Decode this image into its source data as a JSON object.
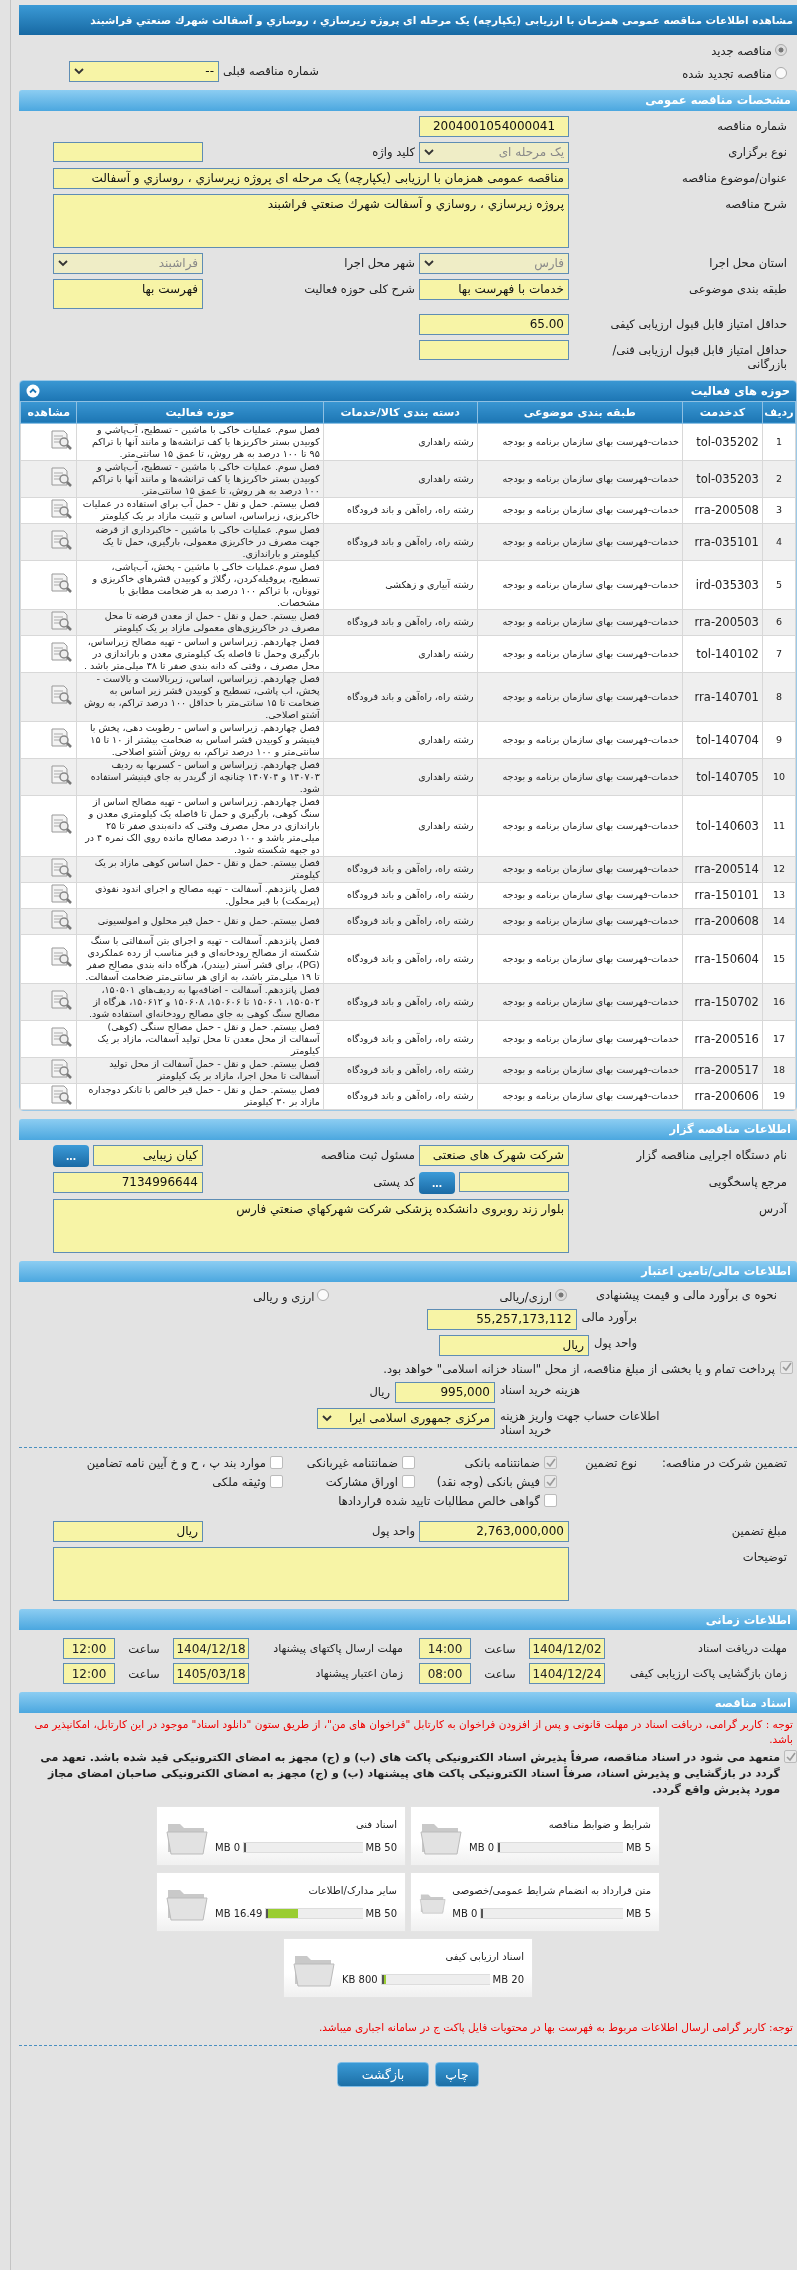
{
  "header": {
    "title": "مشاهده اطلاعات مناقصه عمومی همزمان با ارزیابی (یکپارچه) یک مرحله ای پروژه زیرسازي ، روسازي و آسفالت شهرك صنعتي فراشبند"
  },
  "tender_status": [
    {
      "label": "مناقصه جدید",
      "selected": true
    },
    {
      "label": "مناقصه تجدید شده",
      "selected": false
    }
  ],
  "previous_tender": {
    "label": "شماره مناقصه قبلی",
    "value": "--",
    "kind": "select",
    "disabled": false
  },
  "general": {
    "title": "مشخصات مناقصه عمومی",
    "rows": [
      [
        {
          "label": "شماره مناقصه",
          "kind": "code",
          "value": "2004001054000041"
        }
      ],
      [
        {
          "label": "نوع برگزاری",
          "kind": "select",
          "value": "یک مرحله ای",
          "disabled": true
        },
        {
          "label": "کلید واژه",
          "kind": "text"
        }
      ],
      [
        {
          "label": "عنوان/موضوع مناقصه",
          "kind": "wide",
          "value": "مناقصه عمومی همزمان با ارزیابی (یکپارچه) یک مرحله ای پروژه زیرسازي ، روسازي و آسفالت"
        }
      ],
      [
        {
          "label": "شرح مناقصه",
          "kind": "widearea",
          "value": "پروژه زیرسازي ، روسازي و آسفالت شهرك صنعتي فراشبند"
        }
      ],
      [
        {
          "label": "استان محل اجرا",
          "kind": "select",
          "value": "فارس",
          "disabled": true
        },
        {
          "label": "شهر محل اجرا",
          "kind": "select",
          "value": "فراشبند",
          "disabled": true
        }
      ],
      [
        {
          "label": "طبقه بندی موضوعی",
          "kind": "text",
          "value": "خدمات با فهرست بها"
        },
        {
          "label": "شرح کلی حوزه فعالیت",
          "kind": "area",
          "value": "فهرست بها"
        }
      ],
      [
        {
          "label": "حداقل امتیاز قابل قبول ارزیابی کیفی",
          "kind": "text",
          "value": "65.00"
        }
      ],
      [
        {
          "label": "حداقل امتیاز قابل قبول ارزیابی فنی/بازرگانی",
          "kind": "text"
        }
      ]
    ]
  },
  "activities": {
    "title": "حوزه های فعالیت",
    "columns": [
      "ردیف",
      "کدخدمت",
      "طبقه بندی موضوعی",
      "دسته بندی کالا/خدمات",
      "حوزه فعالیت",
      "مشاهده"
    ],
    "rows": [
      [
        "1",
        "tol-035202",
        "خدمات-فهرست بهای سازمان برنامه و بودجه",
        "رشته راهداری",
        "فصل سوم. عملیات خاکی با ماشین - تسطیح، آب‌پاشي و کوبیدن بستر خاکریزها یا کف ترانشه‌ها و مانند آنها با تراکم ۹۵ تا ۱۰۰ درصد به هر روش، تا عمق ۱۵ سانتی‌متر."
      ],
      [
        "2",
        "tol-035203",
        "خدمات-فهرست بهای سازمان برنامه و بودجه",
        "رشته راهداری",
        "فصل سوم. عملیات خاکی با ماشین - تسطیح، آب‌پاشي و کوبیدن بستر خاکریزها یا کف ترانشه‌ها و مانند آنها با تراکم ۱۰۰ درصد به هر روش، تا عمق ۱۵ سانتی‌متر."
      ],
      [
        "3",
        "rra-200508",
        "خدمات-فهرست بهای سازمان برنامه و بودجه",
        "رشته راه، راه‌آهن و باند فرودگاه",
        "فصل بیستم. حمل و نقل - حمل آب برای استفاده در عملیات خاکریزی، زیراساس، اساس و تثبیت مازاد بر یک کیلومتر"
      ],
      [
        "4",
        "rra-035101",
        "خدمات-فهرست بهای سازمان برنامه و بودجه",
        "رشته راه، راه‌آهن و باند فرودگاه",
        "فصل سوم. عملیات خاکی با ماشین - خاکبرداری از قرضه جهت مصرف در خاکریزی معمولی، بارگیری، حمل تا یک کیلومتر و باراندازی."
      ],
      [
        "5",
        "ird-035303",
        "خدمات-فهرست بهای سازمان برنامه و بودجه",
        "رشته آبیاری و زهکشی",
        "فصل سوم.عملیات خاکی با ماشین - پخش، آب‌پاشی، تسطیح، پروفیله‌کردن، رگلاژ و کوبیدن قشرهای خاکریزی و توونان، با تراکم ۱۰۰ درصد به هر ضخامت مطابق با مشخصات."
      ],
      [
        "6",
        "rra-200503",
        "خدمات-فهرست بهای سازمان برنامه و بودجه",
        "رشته راه، راه‌آهن و باند فرودگاه",
        "فصل بیستم. حمل و نقل - حمل از معدن قرضه تا محل مصرف در خاکریزی‌های معمولی مازاد بر یک کیلومتر"
      ],
      [
        "7",
        "tol-140102",
        "خدمات-فهرست بهای سازمان برنامه و بودجه",
        "رشته راهداری",
        "فصل چهاردهم. زیراساس و اساس - تهیه مصالح زیراساس، بارگیری وحمل تا فاصله یک کیلومتری معدن و باراندازی در محل مصرف ، وقتی که دانه بندی صفر تا ۳۸ میلی‌متر باشد ."
      ],
      [
        "8",
        "rra-140701",
        "خدمات-فهرست بهای سازمان برنامه و بودجه",
        "رشته راه، راه‌آهن و باند فرودگاه",
        "فصل چهاردهم. زیراساس، اساس، زیربالاست و بالاست - پخش، اب پاشی، تسطیح و کوبیدن قشر زیر اساس به ضخامت تا ۱۵ سانتی‌متر با حداقل ۱۰۰ درصد تراکم، به روش آشتو اصلاحی."
      ],
      [
        "9",
        "tol-140704",
        "خدمات-فهرست بهای سازمان برنامه و بودجه",
        "رشته راهداری",
        "فصل چهاردهم. زیراساس و اساس - رطوبت دهی، پخش با فینیشر و کوبیدن قشر اساس به ضخامت بیشتر از ۱۰ تا ۱۵ سانتی‌متر و ۱۰۰ درصد تراکم، به روش آشتو اصلاحی."
      ],
      [
        "10",
        "tol-140705",
        "خدمات-فهرست بهای سازمان برنامه و بودجه",
        "رشته راهداری",
        "فصل چهاردهم. زیراساس و اساس - کسربها به ردیف ۱۴۰۷۰۳ و ۱۴۰۷۰۴ چنانچه از گریدر به جای فینیشر استفاده شود."
      ],
      [
        "11",
        "tol-140603",
        "خدمات-فهرست بهای سازمان برنامه و بودجه",
        "رشته راهداری",
        "فصل چهاردهم. زیراساس و اساس - تهیه مصالح اساس از سنگ کوهی، بارگیری و حمل تا فاصله یک کیلومتری معدن و باراندازی در محل مصرف وقتی که دانه‌بندی صفر تا ۲۵ میلی‌متر باشد و ۱۰۰ درصد مصالح مانده روی الک نمره ۴ در دو جبهه شکسته شود."
      ],
      [
        "12",
        "rra-200514",
        "خدمات-فهرست بهای سازمان برنامه و بودجه",
        "رشته راه، راه‌آهن و باند فرودگاه",
        "فصل بیستم. حمل و نقل - حمل اساس کوهی مازاد بر یک کیلومتر"
      ],
      [
        "13",
        "rra-150101",
        "خدمات-فهرست بهای سازمان برنامه و بودجه",
        "رشته راه، راه‌آهن و باند فرودگاه",
        "فصل پانزدهم. آسفالت - تهیه مصالح و اجرای اندود نفوذی (پریمکت) با قیر محلول."
      ],
      [
        "14",
        "rra-200608",
        "خدمات-فهرست بهای سازمان برنامه و بودجه",
        "رشته راه، راه‌آهن و باند فرودگاه",
        "فصل بیستم. حمل و نقل - حمل قیر محلول و امولسیونی"
      ],
      [
        "15",
        "rra-150604",
        "خدمات-فهرست بهای سازمان برنامه و بودجه",
        "رشته راه، راه‌آهن و باند فرودگاه",
        "فصل پانزدهم. آسفالت - تهیه و اجرای بتن آسفالتی با سنگ شکسته از مصالح رودخانه‌ای و قیر مناسب از رده عملکردی (PG)، برای قشر آستر (بیندر)، هرگاه دانه بندی مصالح صفر تا ۱۹ میلی‌متر باشد، به ازای هر سانتی‌متر ضخامت آسفالت."
      ],
      [
        "16",
        "rra-150702",
        "خدمات-فهرست بهای سازمان برنامه و بودجه",
        "رشته راه، راه‌آهن و باند فرودگاه",
        "فصل پانزدهم. آسفالت - اضافه‌بها به ردیف‌های ۱۵۰۵۰۱، ۱۵۰۵۰۲، ۱۵۰۶۰۱ تا ۱۵۰۶۰۶، ۱۵۰۶۰۸ و ۱۵۰۶۱۲، هرگاه از مصالح سنگ کوهی به جای مصالح رودخانه‌ای استفاده شود."
      ],
      [
        "17",
        "rra-200516",
        "خدمات-فهرست بهای سازمان برنامه و بودجه",
        "رشته راه، راه‌آهن و باند فرودگاه",
        "فصل بیستم. حمل و نقل - حمل مصالح سنگی (کوهی) آسفالت از محل معدن تا محل تولید آسفالت، مازاد بر یک کیلومتر"
      ],
      [
        "18",
        "rra-200517",
        "خدمات-فهرست بهای سازمان برنامه و بودجه",
        "رشته راه، راه‌آهن و باند فرودگاه",
        "فصل بیستم. حمل و نقل - حمل آسفالت از محل تولید آسفالت تا محل اجرا، مازاد بر یک کیلومتر"
      ],
      [
        "19",
        "rra-200606",
        "خدمات-فهرست بهای سازمان برنامه و بودجه",
        "رشته راه، راه‌آهن و باند فرودگاه",
        "فصل بیستم. حمل و نقل - حمل قیر خالص با تانکر دوجداره مازاد بر ۳۰ کیلومتر"
      ]
    ]
  },
  "organizer": {
    "title": "اطلاعات مناقصه گزار",
    "rows": [
      [
        {
          "label": "نام دستگاه اجرایی مناقصه گزار",
          "kind": "text",
          "value": "شرکت شهرک های صنعتی"
        },
        {
          "label": "مسئول ثبت مناقصه",
          "kind": "text",
          "value": "کیان زیبایی",
          "button": "..."
        }
      ],
      [
        {
          "label": "مرجع پاسخگویی",
          "kind": "text",
          "button": "..."
        },
        {
          "label": "کد پستی",
          "kind": "text",
          "value": "7134996644"
        }
      ],
      [
        {
          "label": "آدرس",
          "kind": "widearea",
          "value": "بلوار زند روبروی دانشکده پزشکی شرکت شهرکهاي صنعتي فارس"
        }
      ]
    ]
  },
  "finance": {
    "title": "اطلاعات مالی/تامین اعتبار",
    "method": {
      "label": "نحوه ی برآورد مالی و قیمت پیشنهادی",
      "options": [
        {
          "label": "ارزی/ریالی",
          "selected": true
        },
        {
          "label": "ارزی و ریالی",
          "selected": false
        }
      ]
    },
    "fields": [
      {
        "label": "برآورد مالی",
        "value": "55,257,173,112"
      },
      {
        "label": "واحد پول",
        "value": "ریال"
      }
    ],
    "treasury": {
      "text": "پرداخت تمام و یا بخشی از مبلغ مناقصه، از محل \"اسناد خزانه اسلامی\" خواهد بود.",
      "checked": true
    },
    "document_fee": {
      "label": "هزینه خرید اسناد",
      "value": "995,000",
      "unit": "ریال"
    },
    "account": {
      "label": "اطلاعات حساب جهت واریز هزینه خرید اسناد",
      "value": "مرکزی جمهوری اسلامی ایرا"
    }
  },
  "guarantee": {
    "label": "تضمین شرکت در مناقصه:",
    "type_label": "نوع تضمین",
    "options": [
      {
        "label": "ضمانتنامه بانکی",
        "checked": true
      },
      {
        "label": "ضمانتنامه غیربانکی",
        "checked": false
      },
      {
        "label": "موارد بند پ ، ح و خ آیین نامه تضامین",
        "checked": false
      },
      {
        "label": "فیش بانکی (وجه نقد)",
        "checked": true
      },
      {
        "label": "اوراق مشارکت",
        "checked": false
      },
      {
        "label": "وثیقه ملکی",
        "checked": false
      },
      {
        "label": "گواهی خالص مطالبات تایید شده قراردادها",
        "checked": false
      }
    ],
    "rows": [
      [
        {
          "label": "مبلغ تضمین",
          "kind": "text",
          "value": "2,763,000,000"
        },
        {
          "label": "واحد پول",
          "kind": "text",
          "value": "ریال"
        }
      ],
      [
        {
          "label": "توضیحات",
          "kind": "widearea"
        }
      ]
    ]
  },
  "schedule": {
    "title": "اطلاعات زمانی",
    "items": [
      {
        "label": "مهلت دریافت اسناد",
        "date": "1404/12/02",
        "time_label": "ساعت",
        "time": "14:00"
      },
      {
        "label": "مهلت ارسال پاکتهای پیشنهاد",
        "date": "1404/12/18",
        "time_label": "ساعت",
        "time": "12:00"
      },
      {
        "label": "زمان بازگشایی پاکت ارزیابی کیفی",
        "date": "1404/12/24",
        "time_label": "ساعت",
        "time": "08:00"
      },
      {
        "label": "زمان اعتبار پیشنهاد",
        "date": "1405/03/18",
        "time_label": "ساعت",
        "time": "12:00"
      }
    ]
  },
  "documents": {
    "title": "اسناد مناقصه",
    "notice": "توجه : کاربر گرامی، دریافت اسناد در مهلت قانونی و پس از افزودن فراخوان به کارتابل \"فراخوان های من\"، از طریق ستون \"دانلود اسناد\" موجود در این کارتابل، امکانپذیر می باشد.",
    "commitment": {
      "text": "متعهد می شود در اسناد مناقصه، صرفاً پذیرش اسناد الکترونیکی پاکت های (ب) و (ج) مجهز به امضای الکترونیکی قید شده باشد. تعهد می گردد در بازگشایی و پذیرش اسناد، صرفاً اسناد الکترونیکی پاکت های پیشنهاد (ب) و (ج) مجهز به امضای الکترونیکی صاحبان امضای مجاز مورد پذیرش واقع گردد.",
      "checked": true
    },
    "files": [
      {
        "name": "شرایط و ضوابط مناقصه",
        "max": "5 MB",
        "used": "0 MB",
        "level": 0
      },
      {
        "name": "اسناد فنی",
        "max": "50 MB",
        "used": "0 MB",
        "level": 0
      },
      {
        "name": "متن قرارداد به انضمام شرایط عمومی/خصوصی",
        "max": "5 MB",
        "used": "0 MB",
        "level": 0
      },
      {
        "name": "سایر مدارک/اطلاعات",
        "max": "50 MB",
        "used": "16.49 MB",
        "level": 0.33
      },
      {
        "name": "اسناد ارزیابی کیفی",
        "max": "20 MB",
        "used": "800 KB",
        "level": 0.04
      }
    ],
    "footer_notice": "توجه: کاربر گرامی ارسال اطلاعات مربوط به فهرست بها در محتویات فایل پاکت ج در سامانه اجباری میباشد."
  },
  "actions": [
    {
      "label": "چاپ"
    },
    {
      "label": "بازگشت"
    }
  ]
}
